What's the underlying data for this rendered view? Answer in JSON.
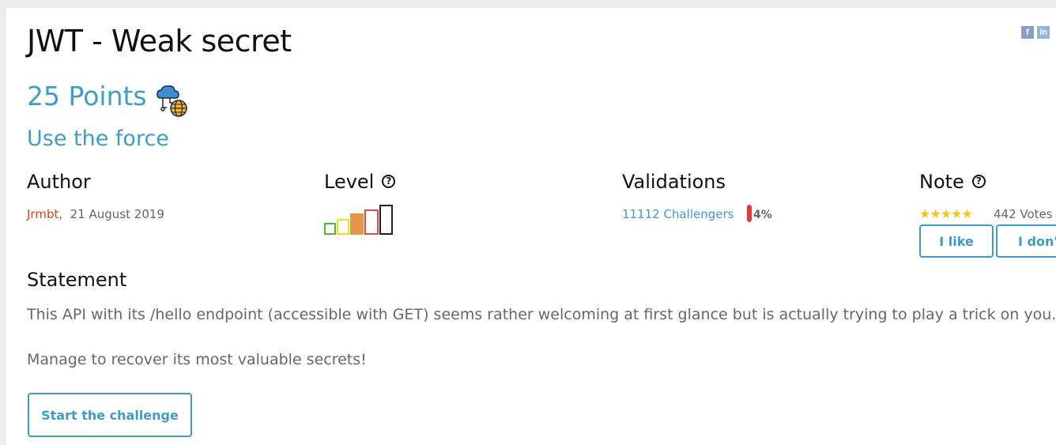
{
  "challenge": {
    "title": "JWT - Weak secret",
    "points": "25 Points",
    "category_icon": "cloud-web-icon",
    "subtitle": "Use the force"
  },
  "share": {
    "facebook": "f",
    "linkedin": "in"
  },
  "author": {
    "label": "Author",
    "name": "Jrmbt",
    "date": "21 August 2019"
  },
  "level": {
    "label": "Level",
    "help_icon": "?",
    "current": 3,
    "max": 5,
    "colors": [
      "#4cba2e",
      "#e6e21e",
      "#e5954a",
      "#d9533b",
      "#222222"
    ]
  },
  "validations": {
    "label": "Validations",
    "challengers": "11112 Challengers",
    "percent": "4%",
    "accent": "#e53935"
  },
  "note": {
    "label": "Note",
    "help_icon": "?",
    "stars": "★★★★★",
    "votes": "442 Votes",
    "like_label": "I like",
    "dislike_label": "I don't"
  },
  "statement": {
    "label": "Statement",
    "paragraphs": [
      "This API with its /hello endpoint (accessible with GET) seems rather welcoming at first glance but is actually trying to play a trick on you.",
      "Manage to recover its most valuable secrets!"
    ]
  },
  "start_button": "Start the challenge",
  "theme": {
    "accent": "#3d9cc8",
    "text_muted": "#666666",
    "author_color": "#d9431e"
  }
}
